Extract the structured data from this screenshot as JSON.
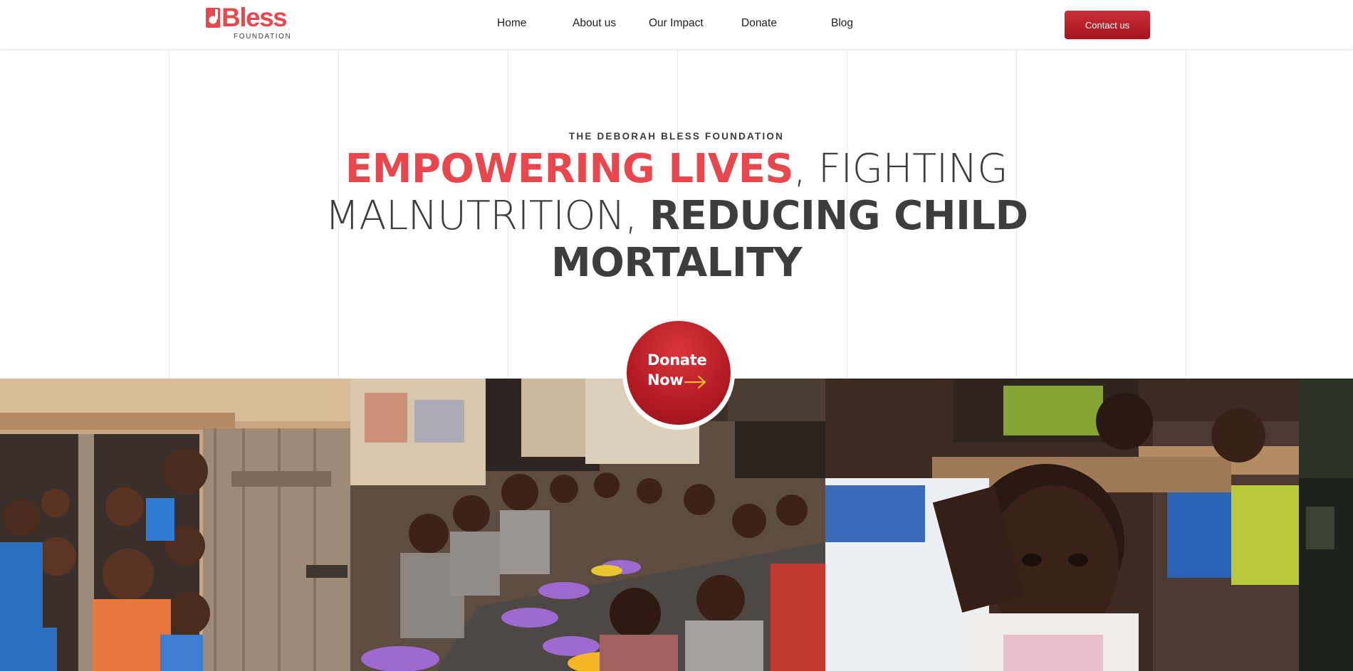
{
  "brand": {
    "name": "Bless",
    "subtitle": "FOUNDATION",
    "accent_color": "#e8474d",
    "primary_dark": "#a3141e"
  },
  "nav": {
    "items": [
      {
        "label": "Home"
      },
      {
        "label": "About us"
      },
      {
        "label": "Our Impact"
      },
      {
        "label": "Donate"
      },
      {
        "label": "Blog"
      }
    ],
    "contact_label": "Contact us"
  },
  "hero": {
    "eyebrow": "THE DEBORAH BLESS FOUNDATION",
    "headline_accent": "EMPOWERING LIVES",
    "headline_part2": ", FIGHTING MALNUTRITION, ",
    "headline_strong": "REDUCING CHILD MORTALITY",
    "donate_line1": "Donate",
    "donate_line2": "Now",
    "donate_icon": "arrow-right-icon"
  },
  "gallery": {
    "photos": [
      {
        "name": "children-at-doorway-photo"
      },
      {
        "name": "children-eating-meal-photo"
      },
      {
        "name": "child-at-desk-photo"
      },
      {
        "name": "partial-photo"
      }
    ]
  }
}
